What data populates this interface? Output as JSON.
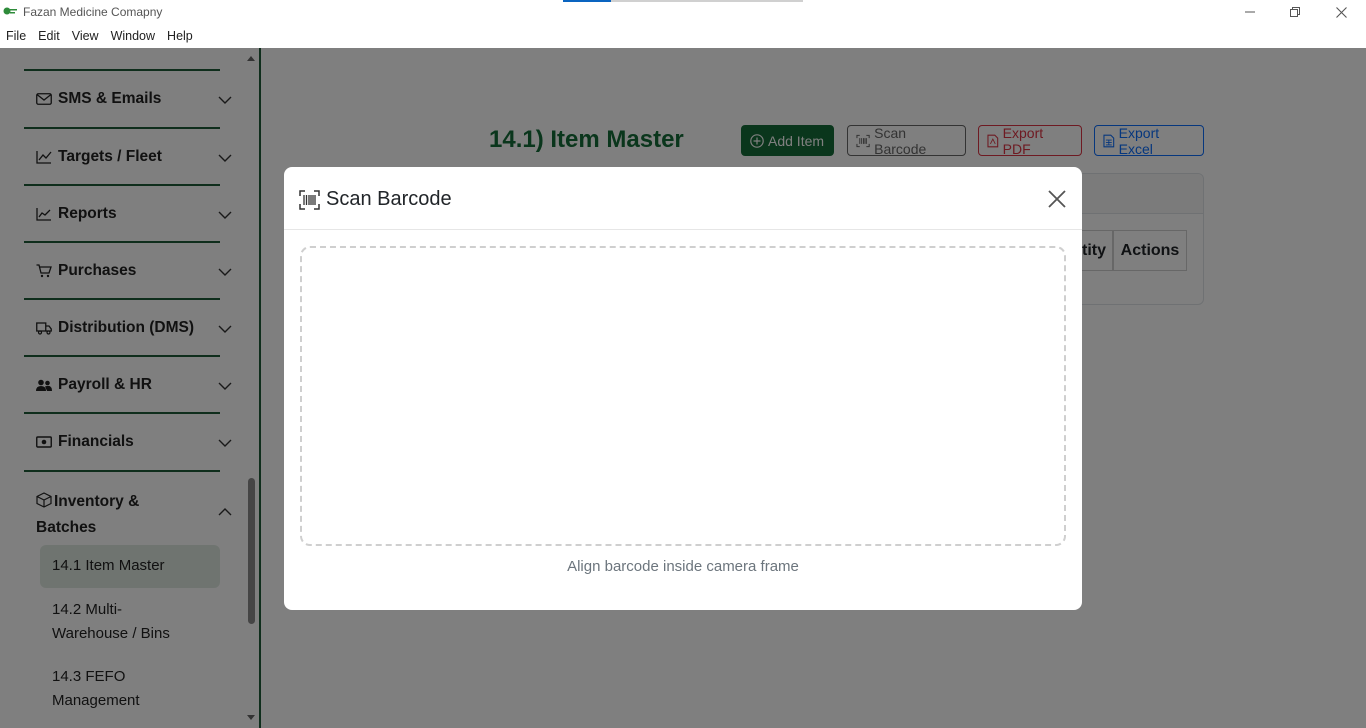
{
  "window": {
    "title": "Fazan Medicine Comapny",
    "progress": 0.2
  },
  "menu": [
    "File",
    "Edit",
    "View",
    "Window",
    "Help"
  ],
  "sidebar": {
    "sections": [
      {
        "label": "SMS & Emails",
        "icon": "envelope-icon",
        "expanded": false
      },
      {
        "label": "Targets / Fleet",
        "icon": "trend-chart-icon",
        "expanded": false
      },
      {
        "label": "Reports",
        "icon": "line-chart-icon",
        "expanded": false
      },
      {
        "label": "Purchases",
        "icon": "cart-icon",
        "expanded": false
      },
      {
        "label": "Distribution (DMS)",
        "icon": "truck-icon",
        "expanded": false
      },
      {
        "label": "Payroll & HR",
        "icon": "people-icon",
        "expanded": false
      },
      {
        "label": "Financials",
        "icon": "cash-icon",
        "expanded": false
      },
      {
        "label": "Inventory & Batches",
        "icon": "box-icon",
        "expanded": true
      }
    ],
    "subitems": [
      {
        "label": "14.1 Item Master",
        "active": true
      },
      {
        "label": "14.2 Multi-Warehouse / Bins",
        "active": false
      },
      {
        "label": "14.3 FEFO Management",
        "active": false
      }
    ]
  },
  "main": {
    "title": "14.1) Item Master",
    "buttons": {
      "add": "Add Item",
      "scan": "Scan Barcode",
      "pdf": "Export PDF",
      "excel": "Export Excel"
    },
    "table_headers": {
      "quantity_partial": "tity",
      "actions": "Actions"
    }
  },
  "modal": {
    "title": "Scan Barcode",
    "hint": "Align barcode inside camera frame"
  },
  "colors": {
    "brand_green": "#146c38",
    "danger": "#dc3545",
    "primary": "#0d6efd"
  }
}
